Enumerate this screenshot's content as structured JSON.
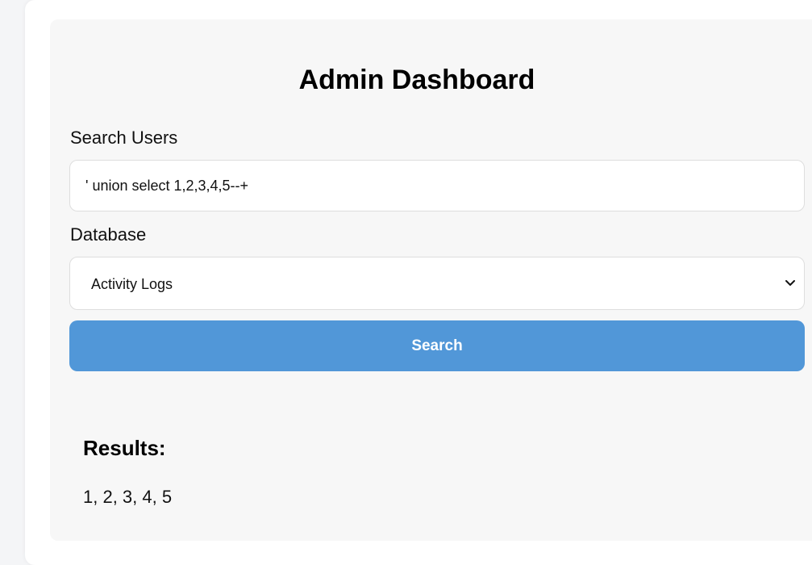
{
  "page": {
    "title": "Admin Dashboard"
  },
  "search": {
    "label": "Search Users",
    "value": "' union select 1,2,3,4,5--+"
  },
  "database": {
    "label": "Database",
    "selected": "Activity Logs"
  },
  "actions": {
    "search_label": "Search"
  },
  "results": {
    "heading": "Results:",
    "value": "1, 2, 3, 4, 5"
  },
  "icons": {
    "select_arrow": "chevron-down-icon"
  },
  "colors": {
    "button": "#5197d8",
    "panel": "#f7f7f7"
  }
}
